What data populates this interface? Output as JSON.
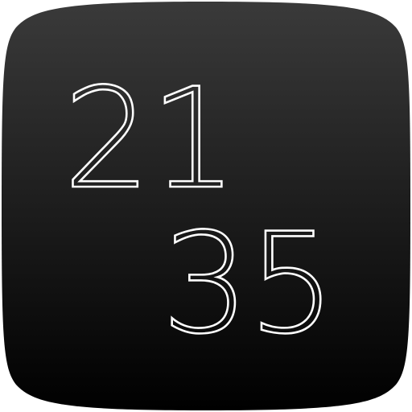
{
  "icon": {
    "kind": "clock-app-icon",
    "background_top": "#3a3a3a",
    "background_bottom": "#000000",
    "digit_color": "#ffffff"
  },
  "time": {
    "hours": "21",
    "minutes": "35"
  }
}
